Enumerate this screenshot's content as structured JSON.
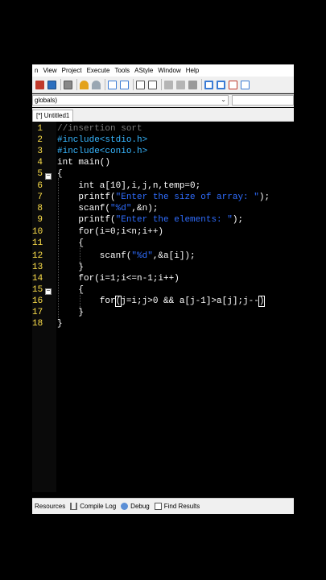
{
  "menu": [
    "n",
    "View",
    "Project",
    "Execute",
    "Tools",
    "AStyle",
    "Window",
    "Help"
  ],
  "toolbar_icons": [
    "compile-icon",
    "run-icon",
    "print-icon",
    "undo-icon",
    "redo-icon",
    "find-icon",
    "replace-icon",
    "indent-icon",
    "unindent-icon",
    "back-icon",
    "forward-icon",
    "bookmark-icon",
    "class-icon",
    "new-class-icon",
    "insert-icon",
    "check-icon",
    "toggle-icon"
  ],
  "scope": {
    "value": "globals)"
  },
  "tab": {
    "label": "[*] Untitled1"
  },
  "line_numbers": [
    "1",
    "2",
    "3",
    "4",
    "5",
    "6",
    "7",
    "8",
    "9",
    "10",
    "11",
    "12",
    "13",
    "14",
    "15",
    "16",
    "17",
    "18"
  ],
  "code": {
    "l1": "//insertion sort",
    "l2": "#include<stdio.h>",
    "l3": "#include<conio.h>",
    "l4": "int main()",
    "l5": "{",
    "l6": "    int a[10],i,j,n,temp=0;",
    "l7a": "    printf(",
    "l7b": "\"Enter the size of array: \"",
    "l7c": ");",
    "l8a": "    scanf(",
    "l8b": "\"%d\"",
    "l8c": ",&n);",
    "l9a": "    printf(",
    "l9b": "\"Enter the elements: \"",
    "l9c": ");",
    "l10": "    for(i=0;i<n;i++)",
    "l11": "    {",
    "l12a": "        scanf(",
    "l12b": "\"%d\"",
    "l12c": ",&a[i]);",
    "l13": "    }",
    "l14": "    for(i=1;i<=n-1;i++)",
    "l15": "    {",
    "l16a": "        for",
    "l16b": "(",
    "l16c": "j=i;j>0 && a[j-1]>a[j];j--",
    "l16d": ")",
    "l17": "    }",
    "l18": "}"
  },
  "bottom_tabs": [
    "Resources",
    "Compile Log",
    "Debug",
    "Find Results"
  ],
  "colors": {
    "comment": "#7a7a7a",
    "preprocessor": "#37b6ff",
    "string": "#2f6dff",
    "line_number": "#ffe14a"
  }
}
